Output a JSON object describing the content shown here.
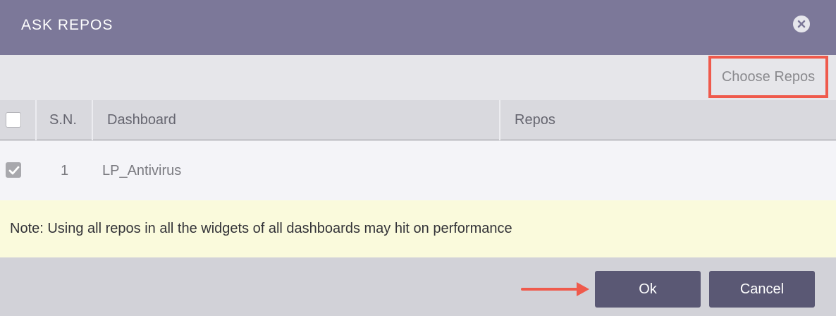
{
  "dialog": {
    "title": "ASK REPOS",
    "close_icon": "close-circle-icon"
  },
  "toolbar": {
    "choose_repos_label": "Choose Repos",
    "highlight_color": "#ef5a4c"
  },
  "table": {
    "columns": [
      "S.N.",
      "Dashboard",
      "Repos"
    ],
    "header_checkbox_checked": false,
    "rows": [
      {
        "checked": true,
        "sn": "1",
        "dashboard": "LP_Antivirus",
        "repos": ""
      }
    ]
  },
  "note": {
    "text": "Note: Using all repos in all the widgets of all dashboards may hit on performance"
  },
  "footer": {
    "ok_label": "Ok",
    "cancel_label": "Cancel",
    "button_color": "#5a5874",
    "arrow_icon": "right-arrow-icon",
    "arrow_color": "#ef5a4c"
  },
  "colors": {
    "titlebar": "#7c7899",
    "note_background": "#fafadc"
  }
}
